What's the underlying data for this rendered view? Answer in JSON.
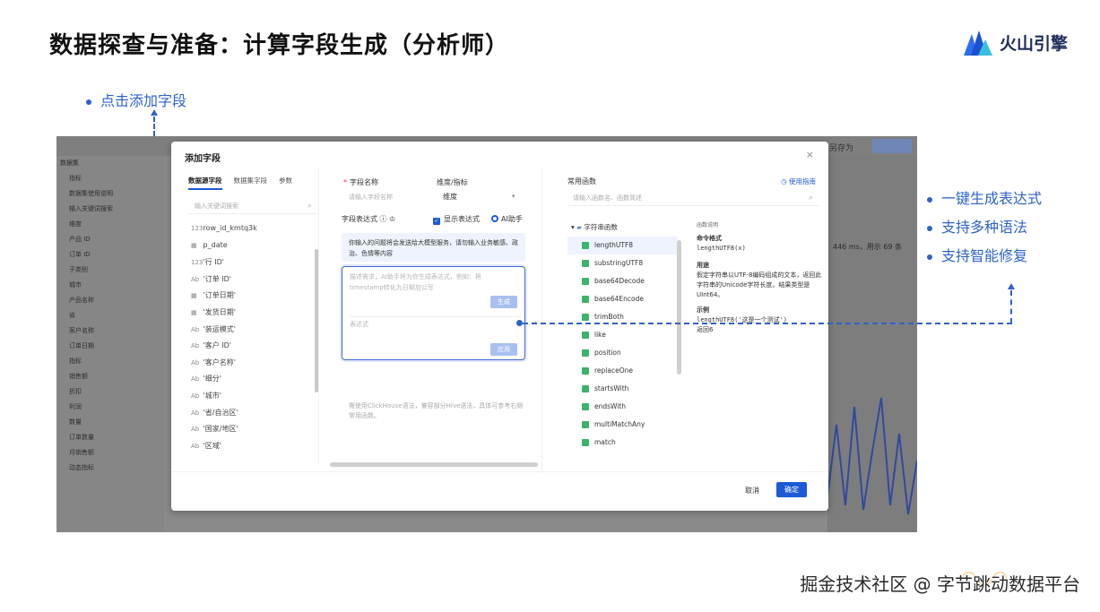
{
  "slide": {
    "title": "数据探查与准备：计算字段生成（分析师）"
  },
  "logo": {
    "text": "火山引擎"
  },
  "annotations": {
    "top": "点击添加字段",
    "right": [
      "一键生成表达式",
      "支持多种语法",
      "支持智能修复"
    ]
  },
  "background": {
    "left_head": "数据集",
    "left_items": [
      "指标",
      "数据集使用说明",
      "输入关键词搜索",
      "维度",
      "产品 ID",
      "订单 ID",
      "子类别",
      "城市",
      "产品名称",
      "省",
      "客户名称",
      "订单日期",
      "指标",
      "销售额",
      "折扣",
      "利润",
      "数量",
      "订单数量",
      "月销售额",
      "动态指标"
    ],
    "save_as": "另存为",
    "stat": "446 ms，用示 69 条"
  },
  "dialog": {
    "title": "添加字段",
    "close": "×",
    "tabs": [
      "数据源字段",
      "数据集字段",
      "参数"
    ],
    "field_search_placeholder": "输入关键词搜索",
    "fields": [
      "row_id_kmtq3k",
      "p_date",
      "'行 ID'",
      "'订单 ID'",
      "'订单日期'",
      "'发货日期'",
      "'装运模式'",
      "'客户 ID'",
      "'客户名称'",
      "'细分'",
      "'城市'",
      "'省/自治区'",
      "'国家/地区'",
      "'区域'"
    ],
    "field_name_label": "字段名称",
    "field_name_placeholder": "请输入字段名称",
    "dim_metric_label": "维度/指标",
    "dim_metric_value": "维度",
    "expr_label": "字段表达式",
    "show_expr": "显示表达式",
    "ai_helper": "AI助手",
    "hint": "你输入的问题将会发送给大模型服务，请勿输入业务敏感、政治、色情等内容",
    "editor_placeholder": "描述需求，AI助手将为你生成表达式，例如：将timestamp转化为日期加公写",
    "generate_btn": "生成",
    "expression_placeholder": "表达式",
    "apply_btn": "应用",
    "note": "需使用ClickHouse语法，兼容部分Hive语法，具体可参考右侧常用函数。",
    "common_functions": "常用函数",
    "guide": "使用指南",
    "fn_search_placeholder": "请输入函数名、函数简述",
    "fn_category": "字符串函数",
    "functions": [
      "lengthUTF8",
      "substringUTF8",
      "base64Decode",
      "base64Encode",
      "trimBoth",
      "like",
      "position",
      "replaceOne",
      "startsWith",
      "endsWith",
      "multiMatchAny",
      "match"
    ],
    "doc": {
      "section": "函数说明",
      "cmd_head": "命令格式",
      "cmd": "lengthUTF8(x)",
      "use_head": "用途",
      "use": "假定字符串以UTF-8编码组成的文本，返回此字符串的Unicode字符长度。结果类型是UInt64。",
      "example_head": "示例",
      "example": "lengthUTF8('这是一个测试')",
      "result": "返回6"
    },
    "cancel": "取消",
    "ok": "确定"
  },
  "watermark": "掘金技术社区 @ 字节跳动数据平台",
  "colors": {
    "accent": "#1d5ad6",
    "annotation": "#2d63c8"
  }
}
